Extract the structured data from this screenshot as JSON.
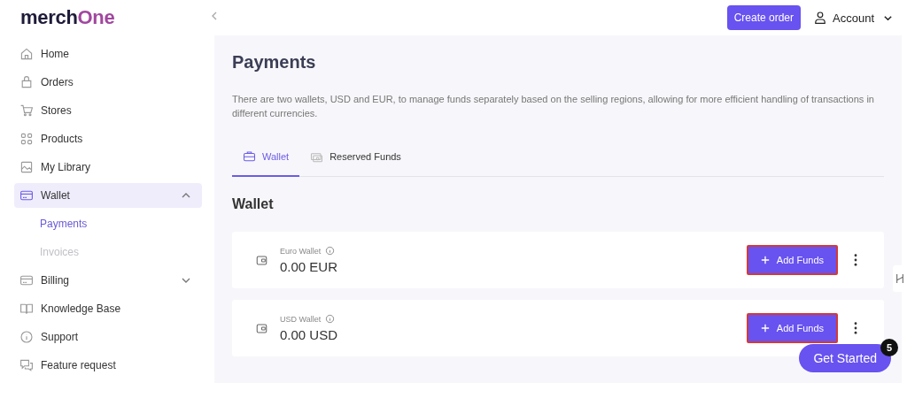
{
  "brand": {
    "part1": "merch",
    "part2": "One"
  },
  "header": {
    "create_button": "Create order",
    "account": "Account"
  },
  "sidebar": {
    "items": [
      {
        "label": "Home",
        "selected": false
      },
      {
        "label": "Orders",
        "selected": false
      },
      {
        "label": "Stores",
        "selected": false
      },
      {
        "label": "Products",
        "selected": false
      },
      {
        "label": "My Library",
        "selected": false
      },
      {
        "label": "Wallet",
        "selected": true,
        "expanded": true,
        "children": [
          {
            "label": "Payments",
            "selected": true
          },
          {
            "label": "Invoices",
            "selected": false
          }
        ]
      },
      {
        "label": "Billing",
        "selected": false,
        "expanded": false
      },
      {
        "label": "Knowledge Base",
        "selected": false
      },
      {
        "label": "Support",
        "selected": false
      },
      {
        "label": "Feature request",
        "selected": false
      }
    ]
  },
  "page": {
    "title": "Payments",
    "description": "There are two wallets, USD and EUR, to manage funds separately based on the selling regions, allowing for more efficient handling of transactions in different currencies."
  },
  "tabs": [
    {
      "label": "Wallet",
      "selected": true
    },
    {
      "label": "Reserved Funds",
      "selected": false
    }
  ],
  "section_title": "Wallet",
  "wallets": [
    {
      "name": "Euro Wallet",
      "amount": "0.00 EUR",
      "button": "Add Funds",
      "highlighted": true
    },
    {
      "name": "USD Wallet",
      "amount": "0.00 USD",
      "button": "Add Funds",
      "highlighted": true
    }
  ],
  "get_started": {
    "label": "Get Started",
    "count": "5"
  }
}
